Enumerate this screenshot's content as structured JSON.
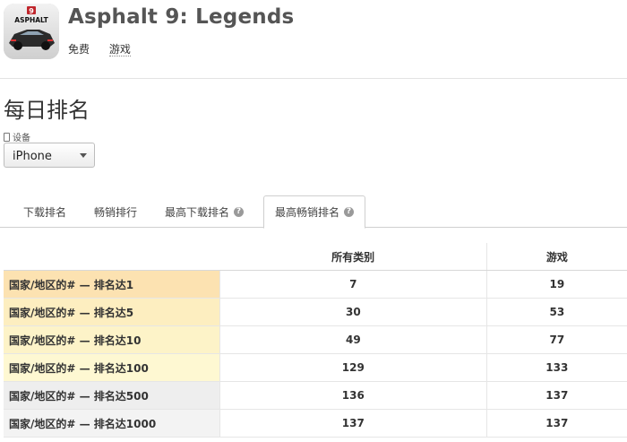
{
  "app": {
    "icon_text": "ASPHALT",
    "icon_badge": "9",
    "title": "Asphalt 9: Legends",
    "price": "免费",
    "genre": "游戏"
  },
  "section": {
    "title": "每日排名",
    "device_label": "设备",
    "device_value": "iPhone"
  },
  "tabs": [
    {
      "label": "下载排名",
      "help": false
    },
    {
      "label": "畅销排行",
      "help": false
    },
    {
      "label": "最高下载排名",
      "help": true
    },
    {
      "label": "最高畅销排名",
      "help": true,
      "active": true
    }
  ],
  "table": {
    "columns": [
      "所有类别",
      "游戏"
    ],
    "rows": [
      {
        "label": "国家/地区的# — 排名达1",
        "all": "7",
        "games": "19",
        "color": "#fce2b1"
      },
      {
        "label": "国家/地区的# — 排名达5",
        "all": "30",
        "games": "53",
        "color": "#fdeec0"
      },
      {
        "label": "国家/地区的# — 排名达10",
        "all": "49",
        "games": "77",
        "color": "#fdf3c8"
      },
      {
        "label": "国家/地区的# — 排名达100",
        "all": "129",
        "games": "133",
        "color": "#fef8d2"
      },
      {
        "label": "国家/地区的# — 排名达500",
        "all": "136",
        "games": "137",
        "color": "#eeeeee"
      },
      {
        "label": "国家/地区的# — 排名达1000",
        "all": "137",
        "games": "137",
        "color": "#f3f3f3"
      }
    ]
  }
}
